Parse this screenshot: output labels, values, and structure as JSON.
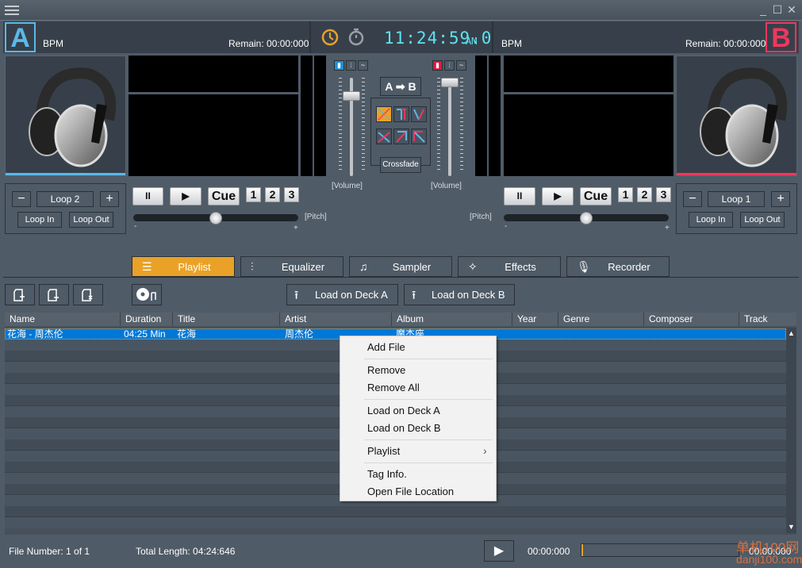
{
  "window": {
    "controls": {
      "minimize": "_",
      "maximize": "☐",
      "close": "✕"
    }
  },
  "deck_a": {
    "letter": "A",
    "color": "#5ab9ea",
    "bpm_label": "BPM",
    "remain": "Remain: 00:00:000",
    "loop_label": "Loop 2",
    "loop_minus": "−",
    "loop_plus": "+",
    "loop_in": "Loop In",
    "loop_out": "Loop Out",
    "pause": "II",
    "play": "▶",
    "cue": "Cue",
    "hotcues": [
      "1",
      "2",
      "3"
    ],
    "pitch_label": "[Pitch]",
    "pitch_minus": "-",
    "pitch_plus": "+",
    "pitch_value": 0.5,
    "volume_label": "[Volume]",
    "volume_value": 0.85
  },
  "deck_b": {
    "letter": "B",
    "color": "#f2365e",
    "bpm_label": "BPM",
    "remain": "Remain: 00:00:000",
    "loop_label": "Loop 1",
    "loop_minus": "−",
    "loop_plus": "+",
    "loop_in": "Loop In",
    "loop_out": "Loop Out",
    "pause": "II",
    "play": "▶",
    "cue": "Cue",
    "hotcues": [
      "1",
      "2",
      "3"
    ],
    "pitch_label": "[Pitch]",
    "pitch_minus": "-",
    "pitch_plus": "+",
    "pitch_value": 0.5,
    "volume_label": "[Volume]",
    "volume_value": 1.0
  },
  "clock": {
    "time": "11:24:59.0",
    "ampm": "AM",
    "clock_icon": "clock-icon",
    "timer_icon": "stopwatch-icon"
  },
  "mixer": {
    "direction": "A ➡ B",
    "crossfade": "Crossfade",
    "active_curve": 0
  },
  "tabs": [
    {
      "label": "Playlist",
      "icon": "☰",
      "active": true
    },
    {
      "label": "Equalizer",
      "icon": "⫶",
      "active": false
    },
    {
      "label": "Sampler",
      "icon": "♫",
      "active": false
    },
    {
      "label": "Effects",
      "icon": "✧",
      "active": false
    },
    {
      "label": "Recorder",
      "icon": "🎙",
      "active": false
    }
  ],
  "toolbar": {
    "load_a": "Load on Deck A",
    "load_b": "Load on Deck B"
  },
  "playlist": {
    "columns": [
      "Name",
      "Duration",
      "Title",
      "Artist",
      "Album",
      "Year",
      "Genre",
      "Composer",
      "Track"
    ],
    "rows": [
      {
        "name": "花海 - 周杰伦",
        "duration": "04:25 Min",
        "title": "花海",
        "artist": "周杰伦",
        "album": "魔杰座",
        "year": "",
        "genre": "",
        "composer": "",
        "track": "",
        "selected": true
      }
    ]
  },
  "context_menu": {
    "items": [
      "Add File",
      "Remove",
      "Remove All",
      "Load on Deck A",
      "Load on Deck B",
      "Playlist",
      "Tag Info.",
      "Open File Location"
    ],
    "submenu_arrow": "›"
  },
  "status": {
    "file_number": "File Number: 1 of 1",
    "total_length": "Total Length: 04:24:646",
    "preview_time": "00:00:000",
    "preview_end": "00:00:000",
    "preview_progress": 0.0
  },
  "watermark": {
    "line1": "单机100网",
    "line2": "danji100.com"
  }
}
